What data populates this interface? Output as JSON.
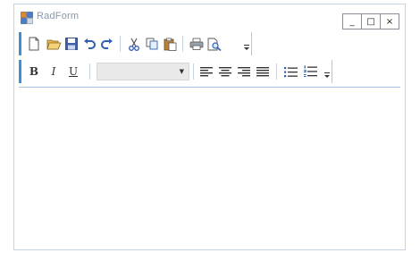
{
  "window": {
    "title": "RadForm",
    "minimize_glyph": "_",
    "maximize_glyph": "□",
    "close_glyph": "×"
  },
  "toolbar_main": {
    "items": [
      "new-document-icon",
      "open-folder-icon",
      "save-icon",
      "undo-icon",
      "redo-icon",
      "cut-icon",
      "copy-icon",
      "paste-icon",
      "print-icon",
      "print-preview-icon"
    ],
    "overflow": "toolbar-overflow-icon"
  },
  "toolbar_format": {
    "bold_label": "B",
    "italic_label": "I",
    "underline_label": "U",
    "font_select_value": "",
    "font_select_arrow": "▼",
    "items": [
      "align-left-icon",
      "align-center-icon",
      "align-right-icon",
      "justify-icon",
      "bulleted-list-icon",
      "numbered-list-icon"
    ],
    "overflow": "toolbar-overflow-icon"
  },
  "editor": {
    "content": ""
  },
  "colors": {
    "accent": "#3c8fd8",
    "window_border": "#c6d3e4",
    "title_text": "#8a98a8",
    "combo_bg": "#e9e9e9"
  }
}
